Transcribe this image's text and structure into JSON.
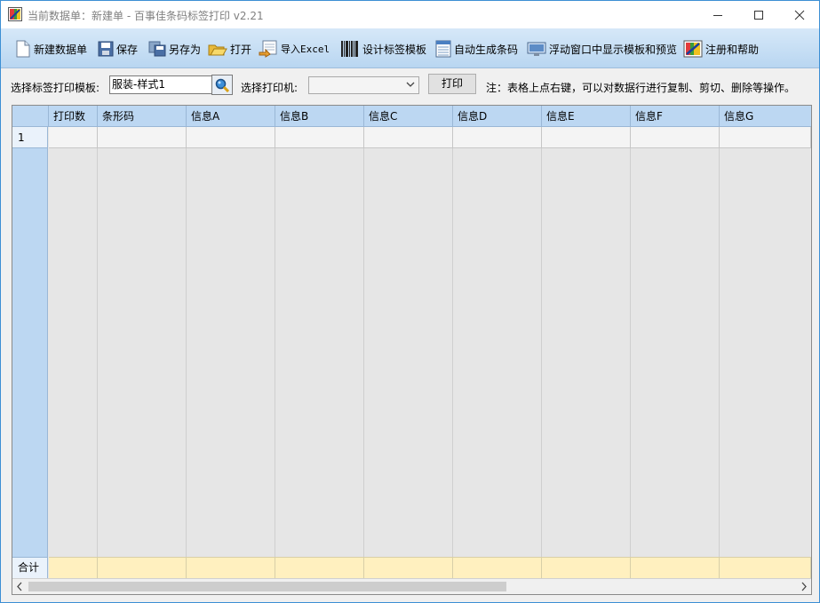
{
  "window": {
    "title": "当前数据单：新建单 - 百事佳条码标签打印 v2.21"
  },
  "toolbar": {
    "new": "新建数据单",
    "save": "保存",
    "save_as": "另存为",
    "open": "打开",
    "import_excel": "导入Excel",
    "design_template": "设计标签模板",
    "auto_barcode": "自动生成条码",
    "float_preview": "浮动窗口中显示模板和预览",
    "register_help": "注册和帮助"
  },
  "options": {
    "template_label": "选择标签打印模板:",
    "template_value": "服装-样式1",
    "printer_label": "选择打印机:",
    "printer_value": "",
    "print_button": "打印",
    "note": "注：表格上点右键，可以对数据行进行复制、剪切、删除等操作。"
  },
  "grid": {
    "columns": [
      "打印数",
      "条形码",
      "信息A",
      "信息B",
      "信息C",
      "信息D",
      "信息E",
      "信息F",
      "信息G"
    ],
    "row_number": "1",
    "total_label": "合计"
  },
  "colors": {
    "toolbar_top": "#d6e8f8",
    "toolbar_bottom": "#b9d6f1",
    "header_blue": "#bcd7f2",
    "total_row": "#fff0bf"
  }
}
